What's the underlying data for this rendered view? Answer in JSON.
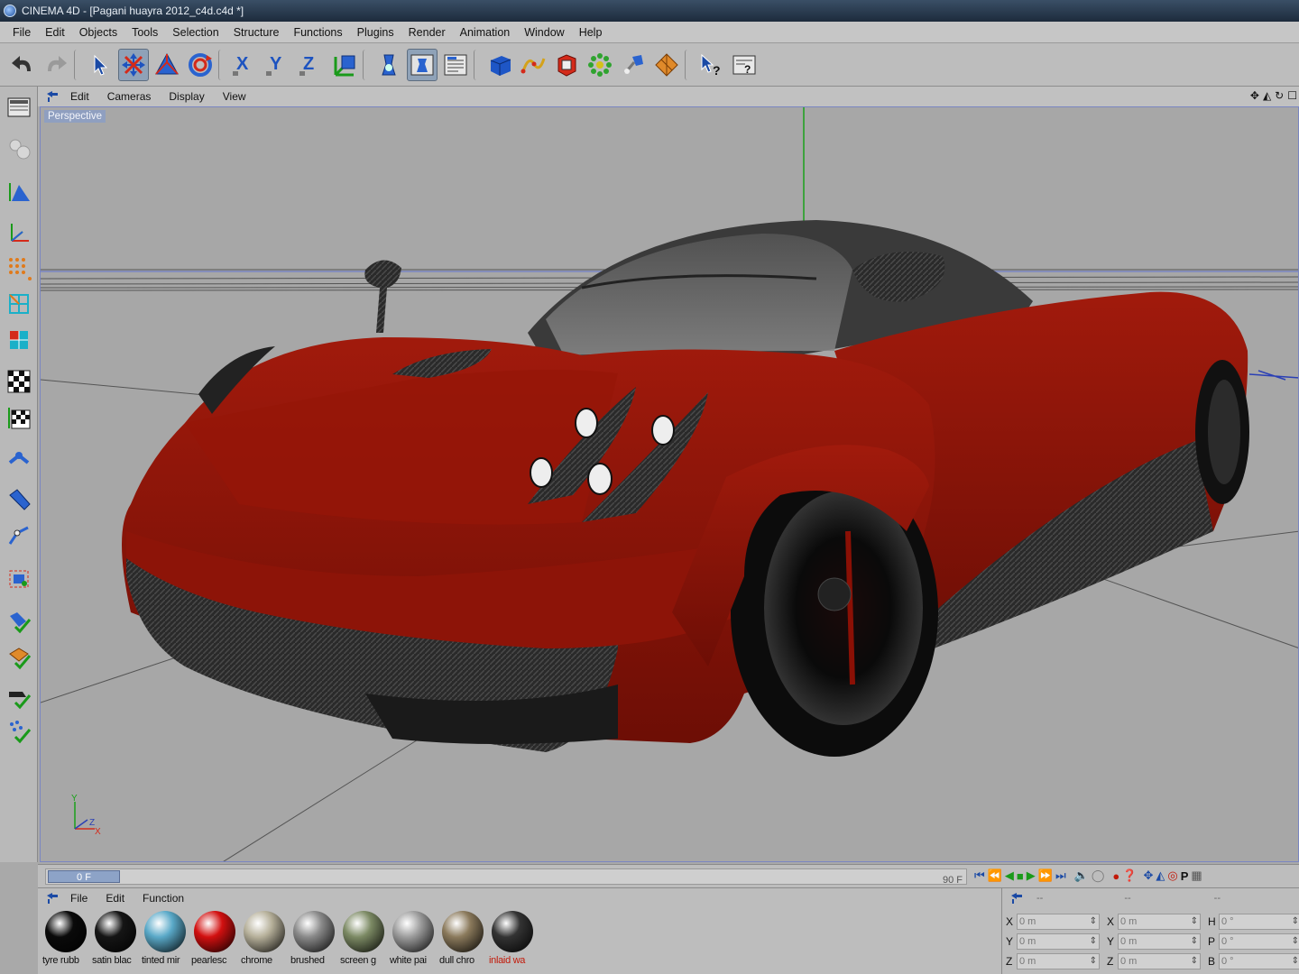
{
  "window": {
    "title": "CINEMA 4D - [Pagani huayra 2012_c4d.c4d *]"
  },
  "menu": [
    "File",
    "Edit",
    "Objects",
    "Tools",
    "Selection",
    "Structure",
    "Functions",
    "Plugins",
    "Render",
    "Animation",
    "Window",
    "Help"
  ],
  "toolbar": {
    "icons": [
      "undo-icon",
      "redo-icon",
      "select-arrow-icon",
      "move-icon",
      "scale-icon",
      "rotate-icon",
      "lock-x-icon",
      "lock-y-icon",
      "lock-z-icon",
      "coordinate-system-icon",
      "render-view-icon",
      "render-picture-viewer-icon",
      "render-settings-icon",
      "cube-primitive-icon",
      "spline-pen-icon",
      "nurbs-icon",
      "array-icon",
      "deformer-icon",
      "scene-floor-icon",
      "help-cursor-icon",
      "info-icon"
    ],
    "labels": {
      "lock_x": "X",
      "lock_y": "Y",
      "lock_z": "Z"
    }
  },
  "left_tools": [
    "layout-icon",
    "camera-spheres-icon",
    "model-tool-icon",
    "object-axis-icon",
    "point-mode-icon",
    "edge-mode-icon",
    "polygon-mode-icon",
    "texture-checker-icon",
    "workplane-icon",
    "animation-tool-icon",
    "paint-tool-icon",
    "ik-tool-icon",
    "uv-edit-icon",
    "enable-snapping-icon",
    "enable-quantize-icon",
    "axis-lock-icon",
    "particles-icon"
  ],
  "viewport": {
    "menu": [
      "Edit",
      "Cameras",
      "Display",
      "View"
    ],
    "label": "Perspective",
    "axis_labels": {
      "y": "Y",
      "z": "Z",
      "x": "X"
    }
  },
  "timeline": {
    "current_frame": "0 F",
    "end_frame": "90 F",
    "letter_p": "P"
  },
  "materials": {
    "menu": [
      "File",
      "Edit",
      "Function"
    ],
    "items": [
      {
        "name": "tyre rubb",
        "color": "#0a0a0a"
      },
      {
        "name": "satin blac",
        "color": "#151515"
      },
      {
        "name": "tinted mir",
        "color": "#5aa9c8"
      },
      {
        "name": "pearlesc",
        "color": "#d21010"
      },
      {
        "name": "chrome",
        "color": "#b6b09a"
      },
      {
        "name": "brushed",
        "color": "#8a8a8a"
      },
      {
        "name": "screen g",
        "color": "#7c8a64"
      },
      {
        "name": "white pai",
        "color": "#9d9d9d"
      },
      {
        "name": "dull chro",
        "color": "#8b7a5c"
      },
      {
        "name": "inlaid wa",
        "color": "#333333",
        "selected": true
      }
    ]
  },
  "coordinates": {
    "header_dashes": [
      "--",
      "--",
      "--"
    ],
    "rows": [
      {
        "a": "X",
        "av": "0 m",
        "b": "X",
        "bv": "0 m",
        "c": "H",
        "cv": "0 °"
      },
      {
        "a": "Y",
        "av": "0 m",
        "b": "Y",
        "bv": "0 m",
        "c": "P",
        "cv": "0 °"
      },
      {
        "a": "Z",
        "av": "0 m",
        "b": "Z",
        "bv": "0 m",
        "c": "B",
        "cv": "0 °"
      }
    ]
  },
  "colors": {
    "car_body": "#8a1207",
    "carbon": "#2e2e2e",
    "accent_blue": "#8da3c7",
    "grid_line": "#444444",
    "y_axis": "#1aa11a"
  }
}
